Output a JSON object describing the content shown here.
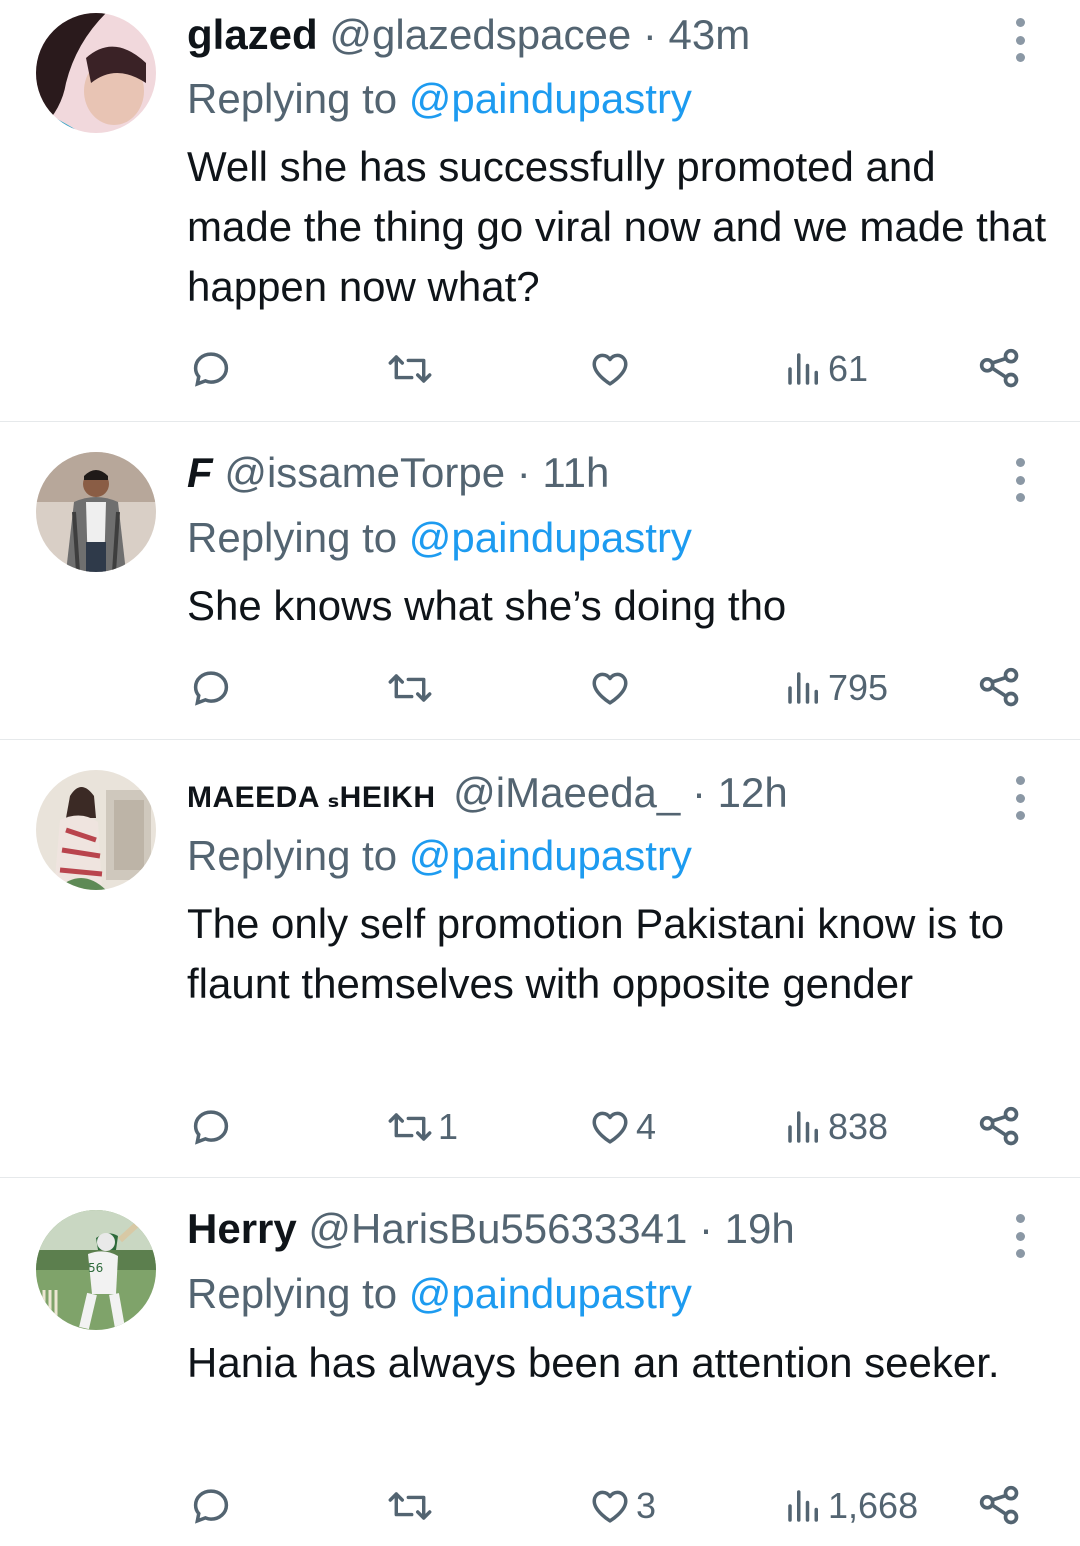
{
  "tweets": [
    {
      "name": "glazed",
      "handle": "@glazedspacee",
      "time": "· 43m",
      "replying_prefix": "Replying to",
      "replying_handle": "@paindupastry",
      "text": "Well she has successfully promoted and made the thing go viral now and we made that happen now what?",
      "retweets": "",
      "likes": "",
      "views": "61"
    },
    {
      "name": "F",
      "handle": "@issameTorpe",
      "time": "· 11h",
      "replying_prefix": "Replying to",
      "replying_handle": "@paindupastry",
      "text": "She knows what she’s doing tho",
      "retweets": "",
      "likes": "",
      "views": "795"
    },
    {
      "name": "MAEEDA ₛHEIKH",
      "handle": "@iMaeeda_",
      "time": "· 12h",
      "replying_prefix": "Replying to",
      "replying_handle": "@paindupastry",
      "text": "The only self promotion Pakistani know is to flaunt themselves with opposite gender",
      "retweets": "1",
      "likes": "4",
      "views": "838"
    },
    {
      "name": "Herry",
      "handle": "@HarisBu55633341",
      "time": "· 19h",
      "replying_prefix": "Replying to",
      "replying_handle": "@paindupastry",
      "text": "Hania has always been an attention seeker.",
      "retweets": "",
      "likes": "3",
      "views": "1,668"
    }
  ],
  "colors": {
    "link": "#1d9bf0",
    "muted": "#536471",
    "text": "#0f1419",
    "divider": "#e6e9eb"
  },
  "icons": [
    "reply-icon",
    "retweet-icon",
    "like-icon",
    "views-icon",
    "share-icon",
    "more-icon"
  ]
}
